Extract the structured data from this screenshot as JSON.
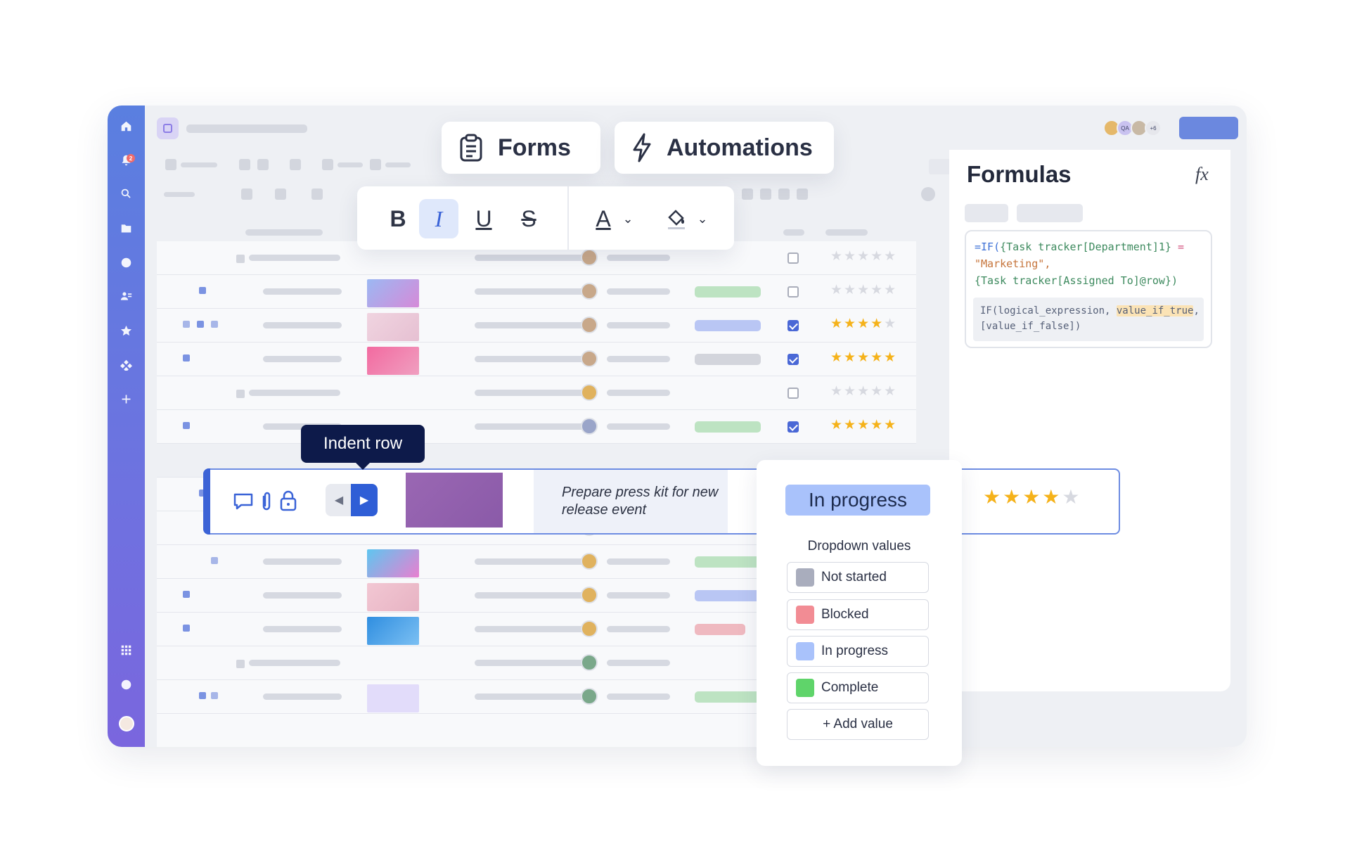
{
  "tabs": {
    "forms_label": "Forms",
    "automations_label": "Automations"
  },
  "formatting": {
    "bold": "B",
    "italic": "I",
    "underline": "U",
    "strikethrough": "S",
    "text_color": "A"
  },
  "notifications": {
    "count": "2"
  },
  "collaborators": {
    "initials": "QA",
    "extra": "+6"
  },
  "formulas_panel": {
    "title": "Formulas",
    "formula_line1_fn": "=IF(",
    "formula_line1_ref": "{Task tracker[Department]1}",
    "formula_line1_op": " =",
    "formula_line2": "\"Marketing\",",
    "formula_line3": "{Task tracker[Assigned To]@row})",
    "hint_line1_a": "IF(logical_expression, ",
    "hint_line1_b": "value_if_true",
    "hint_line1_c": ",",
    "hint_line2": "[value_if_false])"
  },
  "indent_tooltip": "Indent row",
  "featured_row": {
    "task": "Prepare press kit for new  release event",
    "status": "In progress",
    "rating": 4,
    "rating_max": 5
  },
  "status_dropdown": {
    "title": "Dropdown values",
    "options": [
      {
        "label": "Not started",
        "color": "#a9adbd"
      },
      {
        "label": "Blocked",
        "color": "#f28c94"
      },
      {
        "label": "In progress",
        "color": "#a9c2fb"
      },
      {
        "label": "Complete",
        "color": "#5fd46a"
      }
    ],
    "add_label": "+ Add value"
  },
  "rows": [
    {
      "checked": false,
      "rating": 0
    },
    {
      "checked": false,
      "rating": 0
    },
    {
      "checked": true,
      "rating": 4
    },
    {
      "checked": true,
      "rating": 5
    },
    {
      "checked": false,
      "rating": 0
    },
    {
      "checked": true,
      "rating": 5
    }
  ],
  "colors": {
    "accent": "#3c63d6",
    "star": "#f5b21a",
    "rail_top": "#5a7fe0",
    "rail_bottom": "#7a66de"
  }
}
